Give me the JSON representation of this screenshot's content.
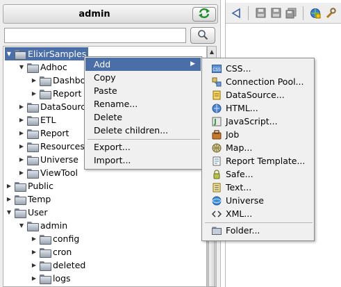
{
  "header": {
    "title": "admin"
  },
  "search": {
    "value": "",
    "placeholder": ""
  },
  "tree": {
    "items": [
      {
        "label": "ElixirSamples",
        "expanded": true,
        "selected": true
      },
      {
        "label": "Adhoc",
        "expanded": true
      },
      {
        "label": "Dashbo",
        "expanded": false
      },
      {
        "label": "Report",
        "expanded": false
      },
      {
        "label": "DataSource",
        "expanded": false
      },
      {
        "label": "ETL",
        "expanded": false
      },
      {
        "label": "Report",
        "expanded": false
      },
      {
        "label": "Resources",
        "expanded": false
      },
      {
        "label": "Universe",
        "expanded": false
      },
      {
        "label": "ViewTool",
        "expanded": false
      },
      {
        "label": "Public",
        "expanded": false
      },
      {
        "label": "Temp",
        "expanded": false
      },
      {
        "label": "User",
        "expanded": true
      },
      {
        "label": "admin",
        "expanded": true
      },
      {
        "label": "config",
        "expanded": false
      },
      {
        "label": "cron",
        "expanded": false
      },
      {
        "label": "deleted",
        "expanded": false
      },
      {
        "label": "logs",
        "expanded": false
      }
    ]
  },
  "context_menu": {
    "items": [
      "Add",
      "Copy",
      "Paste",
      "Rename...",
      "Delete",
      "Delete children...",
      "Export...",
      "Import..."
    ],
    "submenu_arrow": "▶"
  },
  "add_submenu": {
    "items": [
      {
        "label": "CSS...",
        "icon": "css-icon"
      },
      {
        "label": "Connection Pool...",
        "icon": "connection-pool-icon"
      },
      {
        "label": "DataSource...",
        "icon": "datasource-icon"
      },
      {
        "label": "HTML...",
        "icon": "html-icon"
      },
      {
        "label": "JavaScript...",
        "icon": "javascript-icon"
      },
      {
        "label": "Job",
        "icon": "job-icon"
      },
      {
        "label": "Map...",
        "icon": "map-icon"
      },
      {
        "label": "Report Template...",
        "icon": "report-template-icon"
      },
      {
        "label": "Safe...",
        "icon": "safe-icon"
      },
      {
        "label": "Text...",
        "icon": "text-icon"
      },
      {
        "label": "Universe",
        "icon": "universe-icon"
      },
      {
        "label": "XML...",
        "icon": "xml-icon"
      },
      {
        "label": "Folder...",
        "icon": "folder-icon"
      }
    ]
  },
  "colors": {
    "selection": "#4a6ea8",
    "panel_bg": "#eeeeee"
  }
}
